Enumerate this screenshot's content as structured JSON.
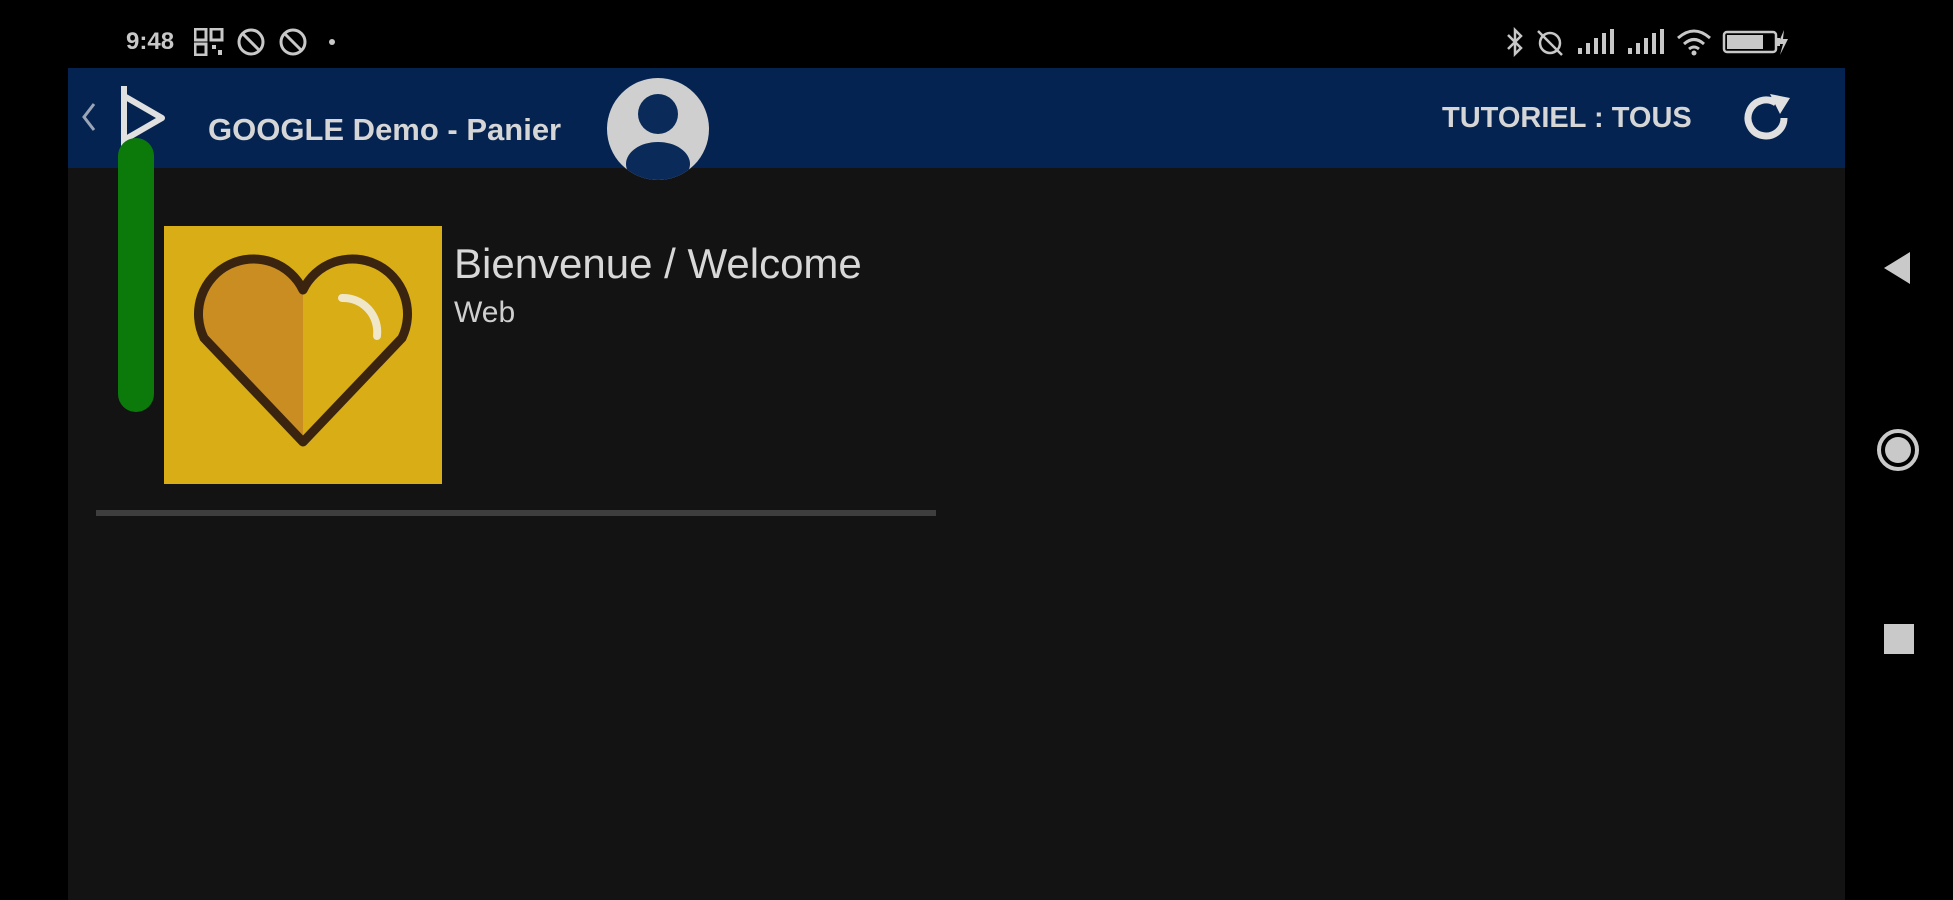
{
  "status_bar": {
    "time": "9:48",
    "left_icons": [
      "qr-code-icon",
      "blocked-notification-icon",
      "blocked-notification-icon",
      "dot-icon"
    ],
    "right_icons": [
      "bluetooth-icon",
      "alarm-off-icon",
      "signal-icon",
      "signal-icon",
      "wifi-icon",
      "battery-charging-icon"
    ]
  },
  "app_bar": {
    "title": "GOOGLE Demo - Panier",
    "tutorial_label": "TUTORIEL : TOUS",
    "background_color": "#042350"
  },
  "list": {
    "items": [
      {
        "title": "Bienvenue / Welcome",
        "subtitle": "Web",
        "icon": "heart-icon",
        "status_color": "#0b7a0b",
        "thumbnail_color": "#d8ad16"
      }
    ]
  },
  "nav_bar": {
    "buttons": [
      "back-triangle-icon",
      "home-circle-icon",
      "recents-square-icon"
    ]
  }
}
